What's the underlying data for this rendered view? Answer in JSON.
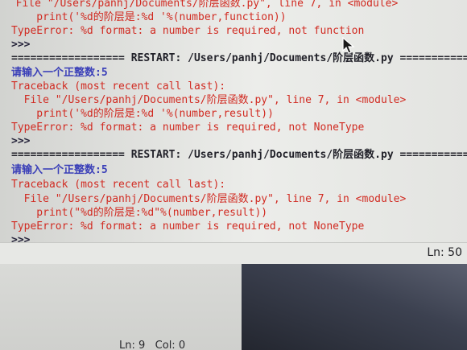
{
  "shell": {
    "lines": [
      {
        "text": "  File \"/Users/panhj/Documents/阶层函数.py\", line 7, in <module>",
        "kind": "error"
      },
      {
        "text": "    print('%d的阶层是:%d '%(number,function))",
        "kind": "error"
      },
      {
        "text": "TypeError: %d format: a number is required, not function",
        "kind": "error"
      },
      {
        "text": ">>>",
        "kind": "prompt"
      },
      {
        "text": "================== RESTART: /Users/panhj/Documents/阶层函数.py ===========",
        "kind": "restart"
      },
      {
        "text": "请输入一个正整数:5",
        "kind": "input"
      },
      {
        "text": "Traceback (most recent call last):",
        "kind": "error"
      },
      {
        "text": "  File \"/Users/panhj/Documents/阶层函数.py\", line 7, in <module>",
        "kind": "error"
      },
      {
        "text": "    print('%d的阶层是:%d '%(number,result))",
        "kind": "error"
      },
      {
        "text": "TypeError: %d format: a number is required, not NoneType",
        "kind": "error"
      },
      {
        "text": ">>>",
        "kind": "prompt"
      },
      {
        "text": "================== RESTART: /Users/panhj/Documents/阶层函数.py ===========",
        "kind": "restart"
      },
      {
        "text": "请输入一个正整数:5",
        "kind": "input"
      },
      {
        "text": "Traceback (most recent call last):",
        "kind": "error"
      },
      {
        "text": "  File \"/Users/panhj/Documents/阶层函数.py\", line 7, in <module>",
        "kind": "error"
      },
      {
        "text": "    print(\"%d的阶层是:%d\"%(number,result))",
        "kind": "error"
      },
      {
        "text": "TypeError: %d format: a number is required, not NoneType",
        "kind": "error"
      },
      {
        "text": ">>>",
        "kind": "prompt"
      }
    ]
  },
  "status_bar": {
    "text": "Ln: 50"
  },
  "lower_window": {
    "status_text": "Ln: 9   Col: 0"
  },
  "colors": {
    "error": "#d12b22",
    "input_prompt": "#3a3fb8",
    "prompt": "#25233a"
  },
  "icons": {
    "cursor": "mouse-pointer-icon"
  }
}
